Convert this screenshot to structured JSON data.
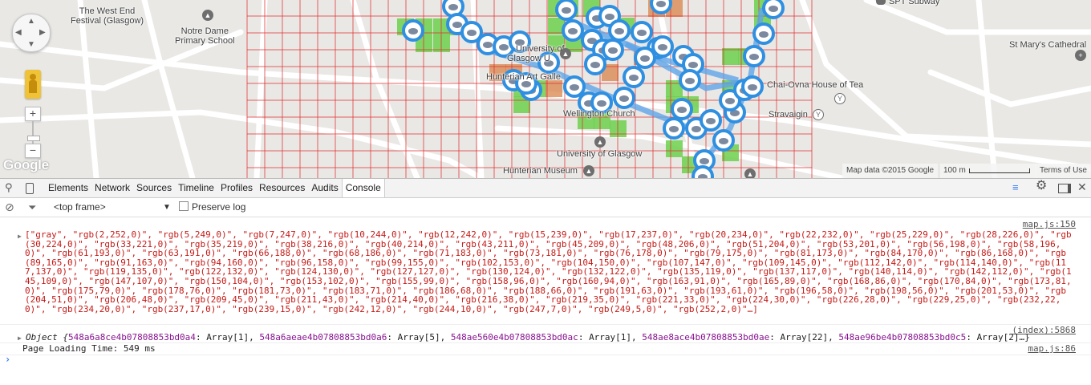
{
  "map": {
    "labels": {
      "west_end_festival": "The West End\nFestival (Glasgow)",
      "notre_dame": "Notre Dame\nPrimary School",
      "spt_subway": "SPT Subway",
      "st_marys": "St Mary's Cathedral",
      "university_of": "University of",
      "glasgow_u": "Glasgow U",
      "hunterian_art": "Hunterian Art Galle",
      "chai_ovna": "Chai-Ovna House of Tea",
      "stravaigin": "Stravaigin",
      "wellington_church": "Wellington Church",
      "university_of_glasgow": "University of Glasgow",
      "hunterian_museum": "Hunterian Museum"
    },
    "google_logo": "Google",
    "attribution": "Map data ©2015 Google",
    "scale_label": "100 m",
    "terms": "Terms of Use",
    "colors": {
      "grid": "#e03030",
      "marker": "#2f8fe0",
      "green": "#6cd04c",
      "orange": "#d9844a",
      "route": "#5fa5e8"
    }
  },
  "devtools": {
    "tabs": [
      "Elements",
      "Network",
      "Sources",
      "Timeline",
      "Profiles",
      "Resources",
      "Audits",
      "Console"
    ],
    "selected_tab": "Console",
    "frame_select": "<top frame>",
    "preserve_log": "Preserve log",
    "console": {
      "messages": [
        {
          "source": "map.js:150",
          "text": "[\"gray\", \"rgb(2,252,0)\", \"rgb(5,249,0)\", \"rgb(7,247,0)\", \"rgb(10,244,0)\", \"rgb(12,242,0)\", \"rgb(15,239,0)\", \"rgb(17,237,0)\", \"rgb(20,234,0)\", \"rgb(22,232,0)\", \"rgb(25,229,0)\", \"rgb(28,226,0)\", \"rgb(30,224,0)\", \"rgb(33,221,0)\", \"rgb(35,219,0)\", \"rgb(38,216,0)\", \"rgb(40,214,0)\", \"rgb(43,211,0)\", \"rgb(45,209,0)\", \"rgb(48,206,0)\", \"rgb(51,204,0)\", \"rgb(53,201,0)\", \"rgb(56,198,0)\", \"rgb(58,196,0)\", \"rgb(61,193,0)\", \"rgb(63,191,0)\", \"rgb(66,188,0)\", \"rgb(68,186,0)\", \"rgb(71,183,0)\", \"rgb(73,181,0)\", \"rgb(76,178,0)\", \"rgb(79,175,0)\", \"rgb(81,173,0)\", \"rgb(84,170,0)\", \"rgb(86,168,0)\", \"rgb(89,165,0)\", \"rgb(91,163,0)\", \"rgb(94,160,0)\", \"rgb(96,158,0)\", \"rgb(99,155,0)\", \"rgb(102,153,0)\", \"rgb(104,150,0)\", \"rgb(107,147,0)\", \"rgb(109,145,0)\", \"rgb(112,142,0)\", \"rgb(114,140,0)\", \"rgb(117,137,0)\", \"rgb(119,135,0)\", \"rgb(122,132,0)\", \"rgb(124,130,0)\", \"rgb(127,127,0)\", \"rgb(130,124,0)\", \"rgb(132,122,0)\", \"rgb(135,119,0)\", \"rgb(137,117,0)\", \"rgb(140,114,0)\", \"rgb(142,112,0)\", \"rgb(145,109,0)\", \"rgb(147,107,0)\", \"rgb(150,104,0)\", \"rgb(153,102,0)\", \"rgb(155,99,0)\", \"rgb(158,96,0)\", \"rgb(160,94,0)\", \"rgb(163,91,0)\", \"rgb(165,89,0)\", \"rgb(168,86,0)\", \"rgb(170,84,0)\", \"rgb(173,81,0)\", \"rgb(175,79,0)\", \"rgb(178,76,0)\", \"rgb(181,73,0)\", \"rgb(183,71,0)\", \"rgb(186,68,0)\", \"rgb(188,66,0)\", \"rgb(191,63,0)\", \"rgb(193,61,0)\", \"rgb(196,58,0)\", \"rgb(198,56,0)\", \"rgb(201,53,0)\", \"rgb(204,51,0)\", \"rgb(206,48,0)\", \"rgb(209,45,0)\", \"rgb(211,43,0)\", \"rgb(214,40,0)\", \"rgb(216,38,0)\", \"rgb(219,35,0)\", \"rgb(221,33,0)\", \"rgb(224,30,0)\", \"rgb(226,28,0)\", \"rgb(229,25,0)\", \"rgb(232,22,0)\", \"rgb(234,20,0)\", \"rgb(237,17,0)\", \"rgb(239,15,0)\", \"rgb(242,12,0)\", \"rgb(244,10,0)\", \"rgb(247,7,0)\", \"rgb(249,5,0)\", \"rgb(252,2,0)\"…]"
        },
        {
          "source": "(index):5868",
          "prefix": "Object {",
          "entries": [
            {
              "key": "548a6a8ce4b07808853bd0a4",
              "val": "Array[1]"
            },
            {
              "key": "548a6aeae4b07808853bd0a6",
              "val": "Array[5]"
            },
            {
              "key": "548ae560e4b07808853bd0ac",
              "val": "Array[1]"
            },
            {
              "key": "548ae8ace4b07808853bd0ae",
              "val": "Array[22]"
            },
            {
              "key": "548ae96be4b07808853bd0c5",
              "val": "Array[2]"
            }
          ],
          "suffix": "…}"
        },
        {
          "source": "map.js:86",
          "text": "Page Loading Time: 549 ms"
        }
      ],
      "prompt": "›"
    }
  }
}
